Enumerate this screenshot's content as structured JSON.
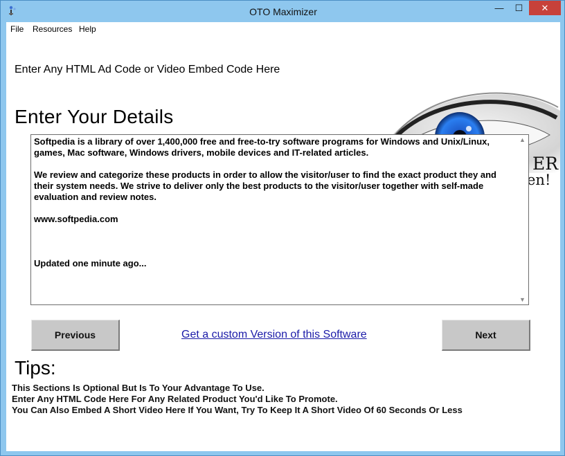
{
  "window": {
    "title": "OTO Maximizer",
    "controls": {
      "minimize": "—",
      "maximize": "☐",
      "close": "✕"
    }
  },
  "menu": {
    "items": [
      "File",
      "Resources",
      "Help"
    ]
  },
  "ad_section": {
    "text": "Enter Any HTML Ad Code or Video Embed Code Here",
    "partial_overlay_1": "ER",
    "partial_overlay_2": "en!"
  },
  "details": {
    "heading": "Enter Your Details",
    "paragraphs": [
      "Softpedia is a library of over 1,400,000 free and free-to-try software programs for Windows and Unix/Linux, games, Mac software, Windows drivers, mobile devices and IT-related articles.",
      "We review and categorize these products in order to allow the visitor/user to find the exact product they and their system needs. We strive to deliver only the best products to the visitor/user together with self-made evaluation and review notes.",
      "www.softpedia.com",
      "",
      "Updated one minute ago..."
    ]
  },
  "navigation": {
    "previous_label": "Previous",
    "next_label": "Next",
    "custom_link": "Get a custom Version of this Software"
  },
  "tips": {
    "heading": "Tips:",
    "lines": [
      "This Sections Is Optional But Is To Your Advantage To Use.",
      "Enter Any HTML Code Here For Any Related Product You'd Like To Promote.",
      "You Can Also Embed A Short Video Here If You Want, Try To Keep It A Short Video Of 60 Seconds Or Less"
    ]
  }
}
